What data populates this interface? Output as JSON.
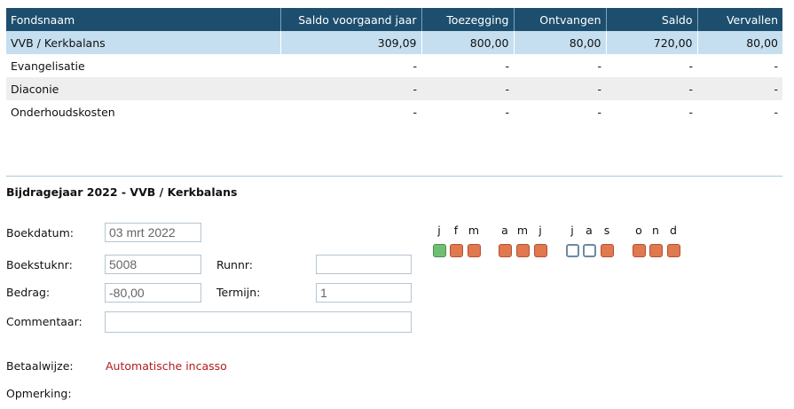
{
  "funds_table": {
    "headers": [
      "Fondsnaam",
      "Saldo voorgaand jaar",
      "Toezegging",
      "Ontvangen",
      "Saldo",
      "Vervallen"
    ],
    "rows": [
      [
        "VVB / Kerkbalans",
        "309,09",
        "800,00",
        "80,00",
        "720,00",
        "80,00"
      ],
      [
        "Evangelisatie",
        "-",
        "-",
        "-",
        "-",
        "-"
      ],
      [
        "Diaconie",
        "-",
        "-",
        "-",
        "-",
        "-"
      ],
      [
        "Onderhoudskosten",
        "-",
        "-",
        "-",
        "-",
        "-"
      ]
    ]
  },
  "detail": {
    "title": "Bijdragejaar 2022 - VVB / Kerkbalans",
    "boekdatum_label": "Boekdatum:",
    "boekdatum_value": "03 mrt 2022",
    "boekstuknr_label": "Boekstuknr:",
    "boekstuknr_value": "5008",
    "runnr_label": "Runnr:",
    "runnr_value": "",
    "bedrag_label": "Bedrag:",
    "bedrag_value": "-80,00",
    "termijn_label": "Termijn:",
    "termijn_value": "1",
    "commentaar_label": "Commentaar:",
    "commentaar_value": "",
    "betaalwijze_label": "Betaalwijze:",
    "betaalwijze_value": "Automatische incasso",
    "opmerking_label": "Opmerking:"
  },
  "months": {
    "letters": [
      "j",
      "f",
      "m",
      "a",
      "m",
      "j",
      "j",
      "a",
      "s",
      "o",
      "n",
      "d"
    ],
    "status": [
      "paid",
      "due",
      "due",
      "due",
      "due",
      "due",
      "open",
      "open",
      "due",
      "due",
      "due",
      "due"
    ],
    "colors": {
      "paid": "#6fbf73",
      "due": "#e07850",
      "open": "#ffffff",
      "header": "#1d4e6e",
      "selected_row": "#c5dff0",
      "link_red": "#b31b1b"
    }
  }
}
